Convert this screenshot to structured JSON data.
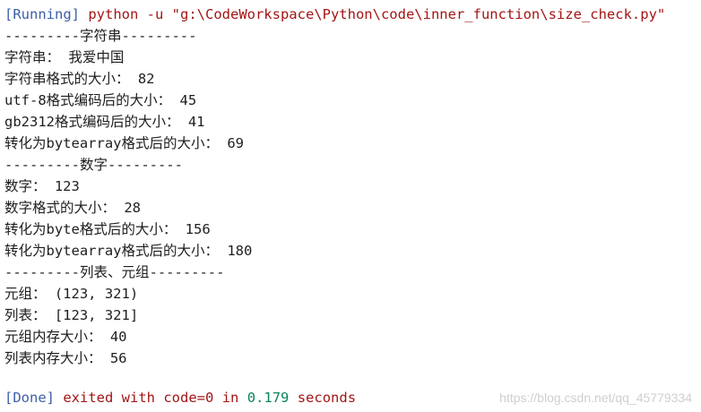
{
  "header": {
    "status_tag": "[Running]",
    "command": "python -u \"g:\\CodeWorkspace\\Python\\code\\inner_function\\size_check.py\""
  },
  "lines": [
    "---------字符串---------",
    "字符串： 我爱中国",
    "字符串格式的大小： 82",
    "utf-8格式编码后的大小： 45",
    "gb2312格式编码后的大小： 41",
    "转化为bytearray格式后的大小： 69",
    "---------数字---------",
    "数字： 123",
    "数字格式的大小： 28",
    "转化为byte格式后的大小： 156",
    "转化为bytearray格式后的大小： 180",
    "---------列表、元组---------",
    "元组： (123, 321)",
    "列表： [123, 321]",
    "元组内存大小： 40",
    "列表内存大小： 56"
  ],
  "footer": {
    "status_tag": "[Done]",
    "exited_with": "exited with",
    "code": "code=0",
    "in": "in",
    "time": "0.179",
    "seconds": "seconds"
  },
  "watermark": "https://blog.csdn.net/qq_45779334",
  "colors": {
    "status_tag": "#3d5fa8",
    "keyword": "#a31515",
    "number": "#098658",
    "text": "#1e1e1e"
  }
}
